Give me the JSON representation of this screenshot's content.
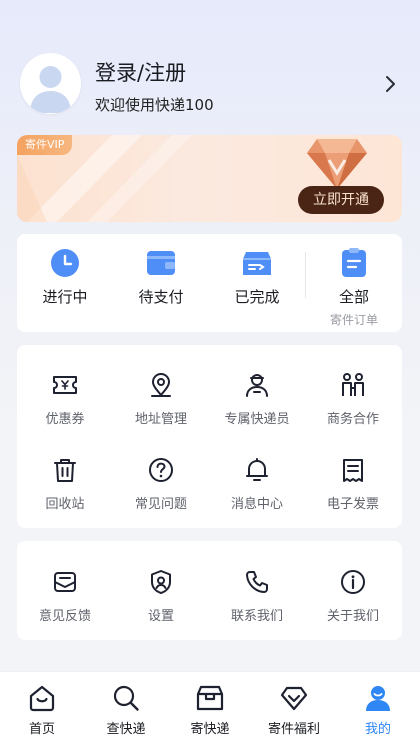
{
  "header": {
    "title": "登录/注册",
    "subtitle": "欢迎使用快递100"
  },
  "vip": {
    "tag": "寄件VIP",
    "button": "立即开通"
  },
  "orders": {
    "items": [
      {
        "label": "进行中",
        "icon": "clock-icon"
      },
      {
        "label": "待支付",
        "icon": "wallet-icon"
      },
      {
        "label": "已完成",
        "icon": "completed-box-icon"
      },
      {
        "label": "全部",
        "sub": "寄件订单",
        "icon": "order-list-icon"
      }
    ]
  },
  "services": {
    "items": [
      {
        "label": "优惠券",
        "icon": "coupon-icon"
      },
      {
        "label": "地址管理",
        "icon": "location-pin-icon"
      },
      {
        "label": "专属快递员",
        "icon": "courier-icon"
      },
      {
        "label": "商务合作",
        "icon": "handshake-icon"
      },
      {
        "label": "回收站",
        "icon": "trash-icon"
      },
      {
        "label": "常见问题",
        "icon": "question-icon"
      },
      {
        "label": "消息中心",
        "icon": "bell-icon"
      },
      {
        "label": "电子发票",
        "icon": "invoice-icon"
      }
    ]
  },
  "tools": {
    "items": [
      {
        "label": "意见反馈",
        "icon": "feedback-icon"
      },
      {
        "label": "设置",
        "icon": "settings-shield-icon"
      },
      {
        "label": "联系我们",
        "icon": "phone-icon"
      },
      {
        "label": "关于我们",
        "icon": "info-icon"
      }
    ]
  },
  "tabbar": {
    "active": "我的",
    "accent": "#2f86f5",
    "items": [
      {
        "label": "首页",
        "icon": "home-icon"
      },
      {
        "label": "查快递",
        "icon": "search-icon"
      },
      {
        "label": "寄快递",
        "icon": "send-box-icon"
      },
      {
        "label": "寄件福利",
        "icon": "gift-diamond-icon"
      },
      {
        "label": "我的",
        "icon": "profile-icon"
      }
    ]
  }
}
